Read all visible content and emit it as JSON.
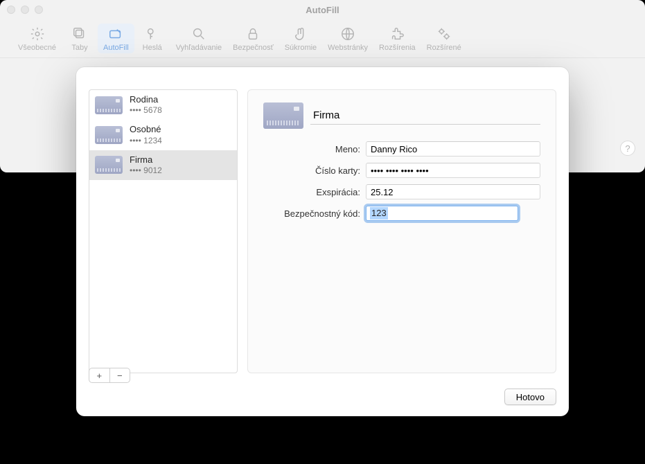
{
  "window": {
    "title": "AutoFill"
  },
  "toolbar": {
    "items": [
      {
        "id": "general",
        "label": "Všeobecné"
      },
      {
        "id": "tabs",
        "label": "Taby"
      },
      {
        "id": "autofill",
        "label": "AutoFill"
      },
      {
        "id": "passwords",
        "label": "Heslá"
      },
      {
        "id": "search",
        "label": "Vyhľadávanie"
      },
      {
        "id": "security",
        "label": "Bezpečnosť"
      },
      {
        "id": "privacy",
        "label": "Súkromie"
      },
      {
        "id": "websites",
        "label": "Webstránky"
      },
      {
        "id": "extensions",
        "label": "Rozšírenia"
      },
      {
        "id": "advanced",
        "label": "Rozšírené"
      }
    ],
    "active": "autofill"
  },
  "help_glyph": "?",
  "cards": [
    {
      "name": "Rodina",
      "masked": "•••• 5678"
    },
    {
      "name": "Osobné",
      "masked": "•••• 1234"
    },
    {
      "name": "Firma",
      "masked": "•••• 9012"
    }
  ],
  "selected_card_index": 2,
  "detail": {
    "description_value": "Firma",
    "labels": {
      "name": "Meno:",
      "number": "Číslo karty:",
      "expiry": "Exspirácia:",
      "cvv": "Bezpečnostný kód:"
    },
    "values": {
      "name": "Danny Rico",
      "number": "•••• •••• •••• ••••",
      "expiry": "25.12",
      "cvv": "123"
    }
  },
  "buttons": {
    "add": "+",
    "remove": "−",
    "done": "Hotovo"
  }
}
